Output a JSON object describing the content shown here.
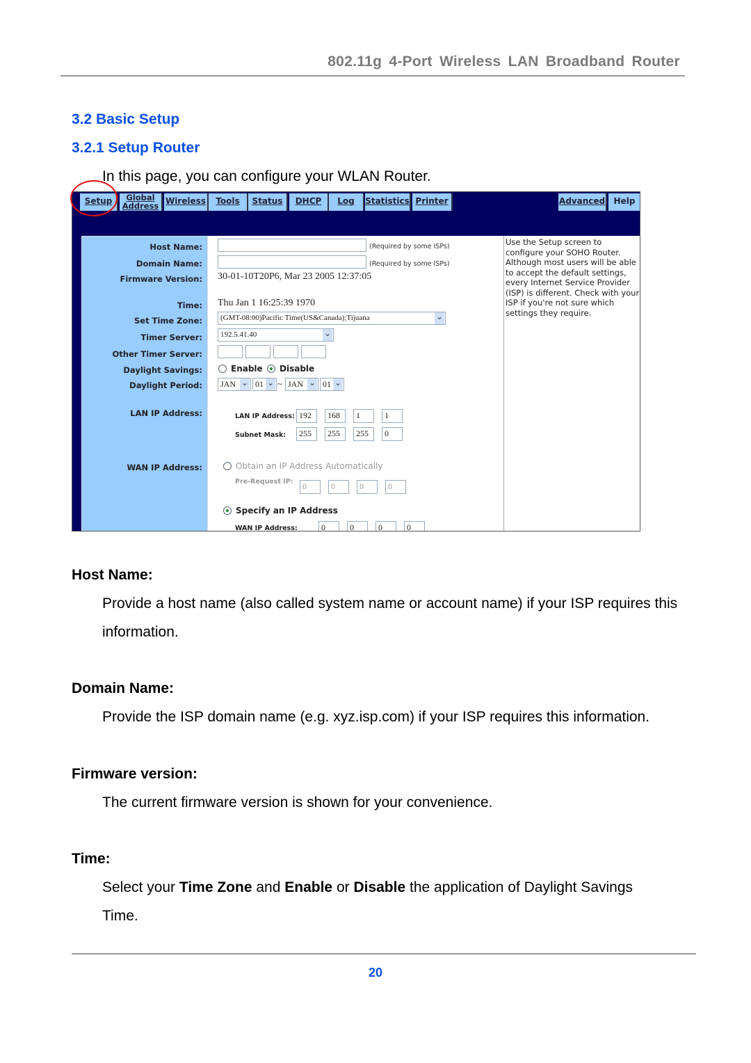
{
  "header": {
    "title": "802.11g 4-Port Wireless LAN Broadband Router"
  },
  "section": {
    "title": "3.2 Basic Setup",
    "subtitle": "3.2.1 Setup Router",
    "intro": "In this page, you can configure your WLAN Router."
  },
  "router_ui": {
    "tabs": [
      "Setup",
      "Global Address",
      "Wireless",
      "Tools",
      "Status",
      "DHCP",
      "Log",
      "Statistics",
      "Printer",
      "Advanced",
      "Help"
    ],
    "active_tab": "Setup",
    "labels": {
      "host": "Host Name:",
      "domain": "Domain Name:",
      "firmware": "Firmware Version:",
      "time": "Time:",
      "tz": "Set Time Zone:",
      "timer": "Timer Server:",
      "other": "Other Timer Server:",
      "ds": "Daylight Savings:",
      "dp": "Daylight Period:",
      "lan": "LAN IP Address:",
      "wan": "WAN IP Address:"
    },
    "required_note": "(Required by some ISPs)",
    "host_name": "",
    "domain_name": "",
    "firmware": "30-01-10T20P6, Mar 23 2005 12:37:05",
    "time": "Thu Jan 1 16:25:39 1970",
    "time_zone": "(GMT-08:00)Pacific Time(US&Canada);Tijuana",
    "timer_server": "192.5.41.40",
    "daylight": {
      "enable": "Enable",
      "disable": "Disable",
      "selected": "Disable"
    },
    "period": {
      "from_month": "JAN",
      "from_day": "01",
      "sep": "~",
      "to_month": "JAN",
      "to_day": "01"
    },
    "lan": {
      "ip_label": "LAN IP Address:",
      "ip": [
        "192",
        "168",
        "1",
        "1"
      ],
      "mask_label": "Subnet Mask:",
      "mask": [
        "255",
        "255",
        "255",
        "0"
      ]
    },
    "wan": {
      "auto_label": "Obtain an IP Address Automatically",
      "pre_label": "Pre-Request IP:",
      "pre": [
        "0",
        "0",
        "0",
        "0"
      ],
      "specify_label": "Specify an IP Address",
      "wan_ip_label": "WAN IP Address:",
      "wan_ip": [
        "0",
        "0",
        "0",
        "0"
      ],
      "selected": "Specify an IP Address"
    },
    "help": "Use the Setup screen to configure your SOHO Router. Although most users will be able to accept the default settings, every Internet Service Provider (ISP) is different. Check with your ISP if you're not sure which settings they require."
  },
  "sections": [
    {
      "title": "Host Name:",
      "body": "Provide a host name (also called system name or account name) if your ISP requires this information."
    },
    {
      "title": "Domain Name:",
      "body": "Provide the ISP domain name (e.g. xyz.isp.com) if your ISP requires this information."
    },
    {
      "title": "Firmware version:",
      "body": "The current firmware version is shown for your convenience."
    },
    {
      "title": "Time:",
      "body_parts": [
        "Select your ",
        "Time Zone",
        " and ",
        "Enable",
        " or ",
        "Disable",
        " the application of Daylight Savings Time."
      ]
    }
  ],
  "footer": {
    "page": "20"
  }
}
